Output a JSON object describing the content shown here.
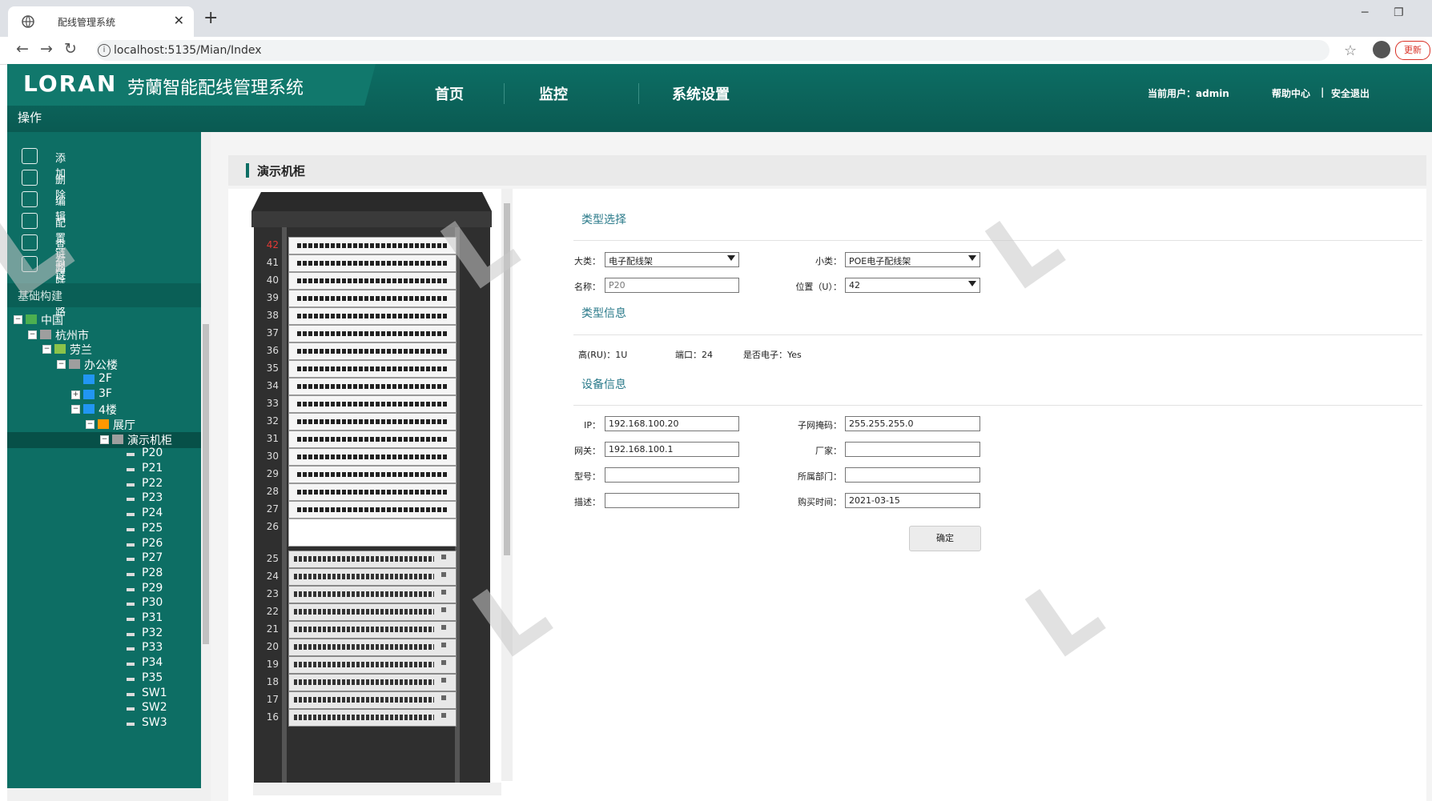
{
  "browser": {
    "tab_title": "配线管理系统",
    "url": "localhost:5135/Mian/Index",
    "update_label": "更新"
  },
  "header": {
    "logo_text": "LORAN",
    "system_title": "劳蘭智能配线管理系统",
    "ops_label": "操作",
    "nav": [
      "首页",
      "监控",
      "系统设置"
    ],
    "current_user": "当前用户：admin",
    "help": "帮助中心",
    "separator": "|",
    "logout": "安全退出"
  },
  "sidebar": {
    "operations": [
      {
        "label": "添加",
        "icon": "add-icon"
      },
      {
        "label": "删除",
        "icon": "trash-icon"
      },
      {
        "label": "编辑",
        "icon": "edit-icon"
      },
      {
        "label": "配置链路",
        "icon": "config-link-icon"
      },
      {
        "label": "查看链路",
        "icon": "view-link-icon"
      },
      {
        "label": "删除链路",
        "icon": "delete-link-icon"
      }
    ],
    "section_title": "基础构建",
    "tree": [
      {
        "label": "中国",
        "toggle": "-",
        "icon": "globe"
      },
      {
        "label": "杭州市",
        "toggle": "-",
        "icon": "building"
      },
      {
        "label": "劳兰",
        "toggle": "-",
        "icon": "company"
      },
      {
        "label": "办公楼",
        "toggle": "-",
        "icon": "building"
      },
      {
        "label": "2F",
        "toggle": "",
        "icon": "floor"
      },
      {
        "label": "3F",
        "toggle": "+",
        "icon": "floor"
      },
      {
        "label": "4楼",
        "toggle": "-",
        "icon": "floor"
      },
      {
        "label": "展厅",
        "toggle": "-",
        "icon": "room"
      },
      {
        "label": "演示机柜",
        "toggle": "-",
        "icon": "cabinet"
      },
      {
        "label": "P20"
      },
      {
        "label": "P21"
      },
      {
        "label": "P22"
      },
      {
        "label": "P23"
      },
      {
        "label": "P24"
      },
      {
        "label": "P25"
      },
      {
        "label": "P26"
      },
      {
        "label": "P27"
      },
      {
        "label": "P28"
      },
      {
        "label": "P29"
      },
      {
        "label": "P30"
      },
      {
        "label": "P31"
      },
      {
        "label": "P32"
      },
      {
        "label": "P33"
      },
      {
        "label": "P34"
      },
      {
        "label": "P35"
      },
      {
        "label": "SW1"
      },
      {
        "label": "SW2"
      },
      {
        "label": "SW3"
      }
    ]
  },
  "main": {
    "breadcrumb": "演示机柜",
    "rack": {
      "units_patch": [
        "42",
        "41",
        "40",
        "39",
        "38",
        "37",
        "36",
        "35",
        "34",
        "33",
        "32",
        "31",
        "30",
        "29",
        "28",
        "27"
      ],
      "unit_blank": "26",
      "units_switch": [
        "25",
        "24",
        "23",
        "22",
        "21",
        "20",
        "19",
        "18",
        "17",
        "16"
      ]
    },
    "type_select": {
      "title": "类型选择",
      "major_label": "大类：",
      "major_value": "电子配线架",
      "minor_label": "小类：",
      "minor_value": "POE电子配线架",
      "name_label": "名称：",
      "name_placeholder": "P20",
      "position_label": "位置（U）：",
      "position_value": "42"
    },
    "type_info": {
      "title": "类型信息",
      "height": "高(RU)：1U",
      "ports": "端口：24",
      "is_electronic": "是否电子：Yes"
    },
    "device_info": {
      "title": "设备信息",
      "ip_label": "IP：",
      "ip_value": "192.168.100.20",
      "mask_label": "子网掩码：",
      "mask_value": "255.255.255.0",
      "gateway_label": "网关：",
      "gateway_value": "192.168.100.1",
      "vendor_label": "厂家：",
      "vendor_value": "",
      "model_label": "型号：",
      "model_value": "",
      "dept_label": "所属部门：",
      "dept_value": "",
      "desc_label": "描述：",
      "desc_value": "",
      "purchase_label": "购买时间：",
      "purchase_value": "2021-03-15"
    },
    "ok_button": "确定"
  },
  "colors": {
    "primary": "#0d6e64",
    "header_dark": "#0a5a52",
    "section_title": "#2a7a8a"
  }
}
